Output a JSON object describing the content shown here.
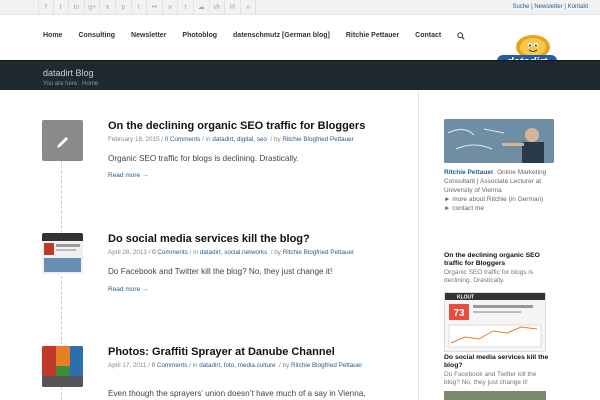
{
  "top": {
    "social_icons": [
      "twitter-icon",
      "facebook-icon",
      "linkedin-icon",
      "googleplus-icon",
      "xing-icon",
      "pinterest-icon",
      "tumblr-icon",
      "flickr-icon",
      "vimeo-icon",
      "reddit-icon",
      "soundcloud-icon",
      "vk-icon",
      "mail-icon",
      "rss-icon"
    ],
    "social_glyphs": [
      "f",
      "t",
      "in",
      "g+",
      "x",
      "p",
      "t",
      "••",
      "v",
      "r",
      "☁",
      "vk",
      "✉",
      "»"
    ],
    "links": [
      "Suche",
      "Newsletter",
      "Kontakt"
    ],
    "sep": " | "
  },
  "nav": {
    "items": [
      "Home",
      "Consulting",
      "Newsletter",
      "Photoblog",
      "datenschmutz [German blog]",
      "Ritchie Pettauer",
      "Contact"
    ],
    "search_icon": "🔍"
  },
  "logo": {
    "text": "datadirt",
    "colors": {
      "blue": "#1f5ea8",
      "orange": "#e8a21b"
    }
  },
  "titlebar": {
    "title": "datadirt Blog",
    "breadcrumb_prefix": "You are here:",
    "breadcrumb_home": "Home"
  },
  "posts": [
    {
      "title": "On the declining organic SEO traffic for Bloggers",
      "date": "February 18, 2015",
      "comments": "0 Comments",
      "in_label": "in",
      "categories": "datadirt, digital, seo",
      "by_label": "by",
      "author": "Ritchie Blogfried Pettauer",
      "excerpt": "Organic SEO traffic for blogs is declining. Drastically.",
      "more": "Read more →",
      "thumb_type": "pencil"
    },
    {
      "title": "Do social media services kill the blog?",
      "date": "April 28, 2013",
      "comments": "0 Comments",
      "in_label": "in",
      "categories": "datadirt, social.networks",
      "by_label": "by",
      "author": "Ritchie Blogfried Pettauer",
      "excerpt": "Do Facebook and Twitter kill the blog? No, they just change it!",
      "more": "Read more →",
      "thumb_type": "screenshot"
    },
    {
      "title": "Photos: Graffiti Sprayer at Danube Channel",
      "date": "April 17, 2011",
      "comments": "0 Comments",
      "in_label": "in",
      "categories": "datadirt, foto, media.culture",
      "by_label": "by",
      "author": "Ritchie Blogfried Pettauer",
      "excerpt": "Even though the sprayers’ union doesn’t have much of a say in Vienna,",
      "more": "",
      "thumb_type": "photo"
    }
  ],
  "sidebar": {
    "bio_name": "Ritchie Pettauer",
    "bio_text": ". Online Marketing Consultant | Associate Lecturer at University of Vienna",
    "more_link": "► more about Ritchie (in German)",
    "contact_link": "► contact me",
    "widget_items": [
      {
        "title": "On the declining organic SEO traffic for Bloggers",
        "excerpt": "Organic SEO traffic for blogs is declining. Drastically."
      },
      {
        "title": "Do social media services kill the blog?",
        "excerpt": "Do Facebook and Twitter kill the blog? No, they just change it!"
      }
    ],
    "klout_label": "KLOUT",
    "klout_score": "73"
  }
}
